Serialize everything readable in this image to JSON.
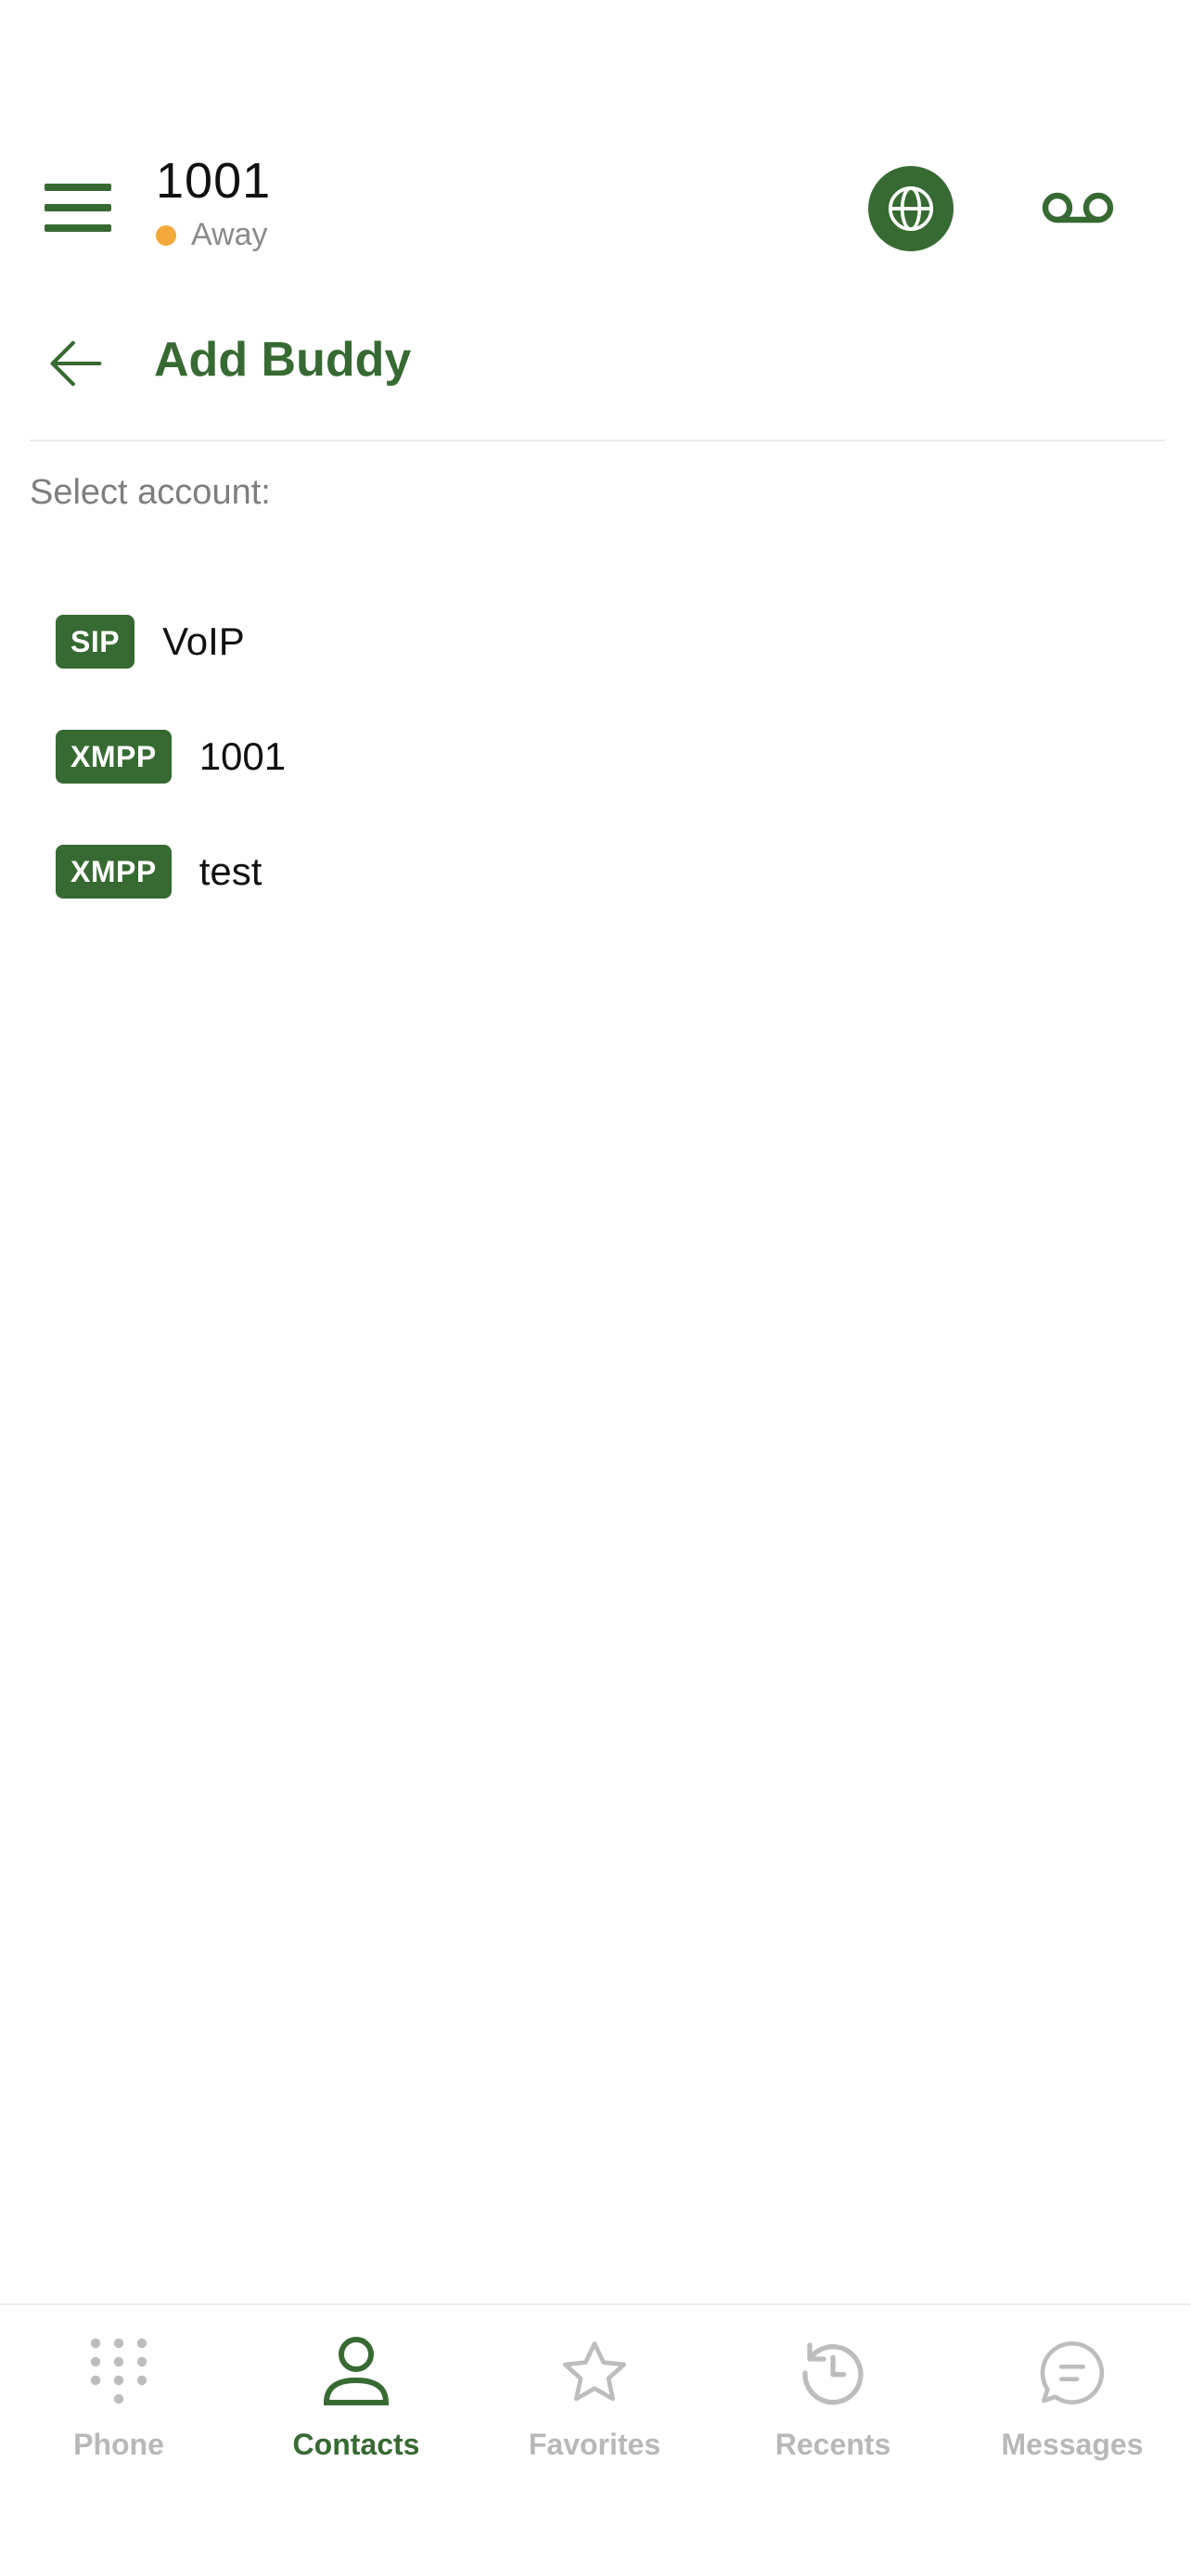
{
  "header": {
    "account_title": "1001",
    "status_text": "Away",
    "status_color": "#f3a93a",
    "menu_icon": "hamburger-icon",
    "globe_icon": "globe-icon",
    "voicemail_icon": "voicemail-icon"
  },
  "screen": {
    "title": "Add Buddy",
    "back_icon": "arrow-left-icon",
    "select_label": "Select account:"
  },
  "accounts": [
    {
      "type": "SIP",
      "name": "VoIP"
    },
    {
      "type": "XMPP",
      "name": "1001"
    },
    {
      "type": "XMPP",
      "name": "test"
    }
  ],
  "tabs": [
    {
      "label": "Phone",
      "icon": "dialpad-icon",
      "active": false
    },
    {
      "label": "Contacts",
      "icon": "person-icon",
      "active": true
    },
    {
      "label": "Favorites",
      "icon": "star-icon",
      "active": false
    },
    {
      "label": "Recents",
      "icon": "history-icon",
      "active": false
    },
    {
      "label": "Messages",
      "icon": "chat-bubble-icon",
      "active": false
    }
  ],
  "colors": {
    "accent": "#376a32",
    "inactive": "#b8b8b8",
    "away": "#f3a93a"
  }
}
